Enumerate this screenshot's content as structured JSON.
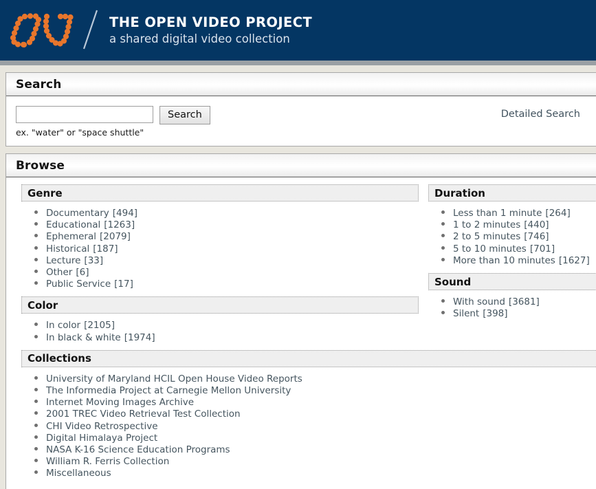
{
  "masthead": {
    "logo_alt": "OV",
    "title": "THE OPEN VIDEO PROJECT",
    "subtitle": "a shared digital video collection"
  },
  "search_panel": {
    "title": "Search",
    "input_value": "",
    "input_placeholder": "",
    "button_label": "Search",
    "hint": "ex. \"water\" or \"space shuttle\"",
    "detailed_search_label": "Detailed Search"
  },
  "browse_panel": {
    "title": "Browse",
    "facets": {
      "genre": {
        "header": "Genre",
        "items": [
          {
            "label": "Documentary",
            "count": "[494]"
          },
          {
            "label": "Educational",
            "count": "[1263]"
          },
          {
            "label": "Ephemeral",
            "count": "[2079]"
          },
          {
            "label": "Historical",
            "count": "[187]"
          },
          {
            "label": "Lecture",
            "count": "[33]"
          },
          {
            "label": "Other",
            "count": "[6]"
          },
          {
            "label": "Public Service",
            "count": "[17]"
          }
        ]
      },
      "color": {
        "header": "Color",
        "items": [
          {
            "label": "In color",
            "count": "[2105]"
          },
          {
            "label": "In black & white",
            "count": "[1974]"
          }
        ]
      },
      "duration": {
        "header": "Duration",
        "items": [
          {
            "label": "Less than 1 minute",
            "count": "[264]"
          },
          {
            "label": "1 to 2 minutes",
            "count": "[440]"
          },
          {
            "label": "2 to 5 minutes",
            "count": "[746]"
          },
          {
            "label": "5 to 10 minutes",
            "count": "[701]"
          },
          {
            "label": "More than 10 minutes",
            "count": "[1627]"
          }
        ]
      },
      "sound": {
        "header": "Sound",
        "items": [
          {
            "label": "With sound",
            "count": "[3681]"
          },
          {
            "label": "Silent",
            "count": "[398]"
          }
        ]
      },
      "collections": {
        "header": "Collections",
        "items": [
          {
            "label": "University of Maryland HCIL Open House Video Reports",
            "count": ""
          },
          {
            "label": "The Informedia Project at Carnegie Mellon University",
            "count": ""
          },
          {
            "label": "Internet Moving Images Archive",
            "count": ""
          },
          {
            "label": "2001 TREC Video Retrieval Test Collection",
            "count": ""
          },
          {
            "label": "CHI Video Retrospective",
            "count": ""
          },
          {
            "label": "Digital Himalaya Project",
            "count": ""
          },
          {
            "label": "NASA K-16 Science Education Programs",
            "count": ""
          },
          {
            "label": "William R. Ferris Collection",
            "count": ""
          },
          {
            "label": "Miscellaneous",
            "count": ""
          }
        ]
      }
    }
  },
  "colors": {
    "masthead_bg": "#043663",
    "logo_orange": "#e8762c",
    "page_bg": "#e8e6de",
    "link": "#45555f",
    "facet_header_bg": "#efefef"
  }
}
